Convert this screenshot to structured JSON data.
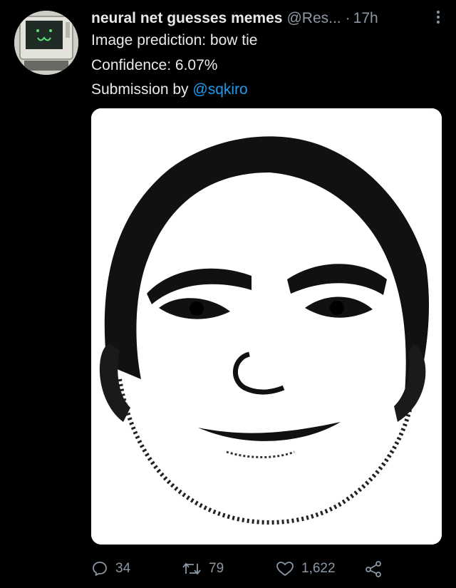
{
  "tweet": {
    "author_name": "neural net guesses memes",
    "author_handle": "@Res...",
    "separator": "·",
    "time": "17h",
    "line1": "Image prediction: bow tie",
    "line2": "Confidence: 6.07%",
    "line3_prefix": "Submission by ",
    "line3_mention": "@sqkiro"
  },
  "actions": {
    "replies": "34",
    "retweets": "79",
    "likes": "1,622"
  },
  "icons": {
    "reply": "speech-bubble-icon",
    "retweet": "retweet-arrows-icon",
    "like": "heart-icon",
    "share": "share-icon",
    "more": "vertical-ellipsis-icon"
  },
  "colors": {
    "background": "#000000",
    "text": "#e7e9ea",
    "secondary": "#8b98a5",
    "accent": "#1d9bf0"
  }
}
